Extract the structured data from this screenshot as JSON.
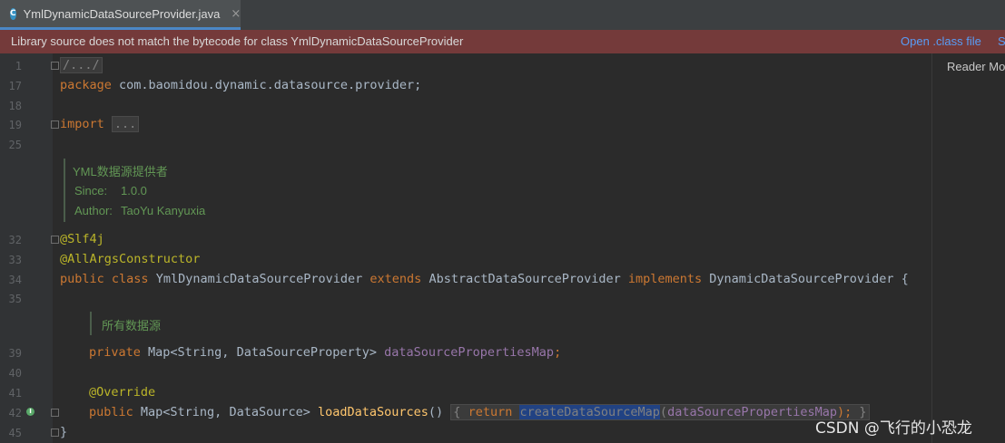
{
  "tab": {
    "label": "YmlDynamicDataSourceProvider.java",
    "icon": "C",
    "close": "×"
  },
  "banner": {
    "message": "Library source does not match the bytecode for class YmlDynamicDataSourceProvider",
    "open_class_file": "Open .class file",
    "more": "S"
  },
  "reader_mode": "Reader Mo",
  "lines": {
    "l1": "1",
    "l17": "17",
    "l18": "18",
    "l19": "19",
    "l25": "25",
    "l32": "32",
    "l33": "33",
    "l34": "34",
    "l35": "35",
    "l39": "39",
    "l40": "40",
    "l41": "41",
    "l42": "42",
    "l45": "45"
  },
  "code": {
    "fold_header": "/.../",
    "package_kw": "package",
    "package_name": " com.baomidou.dynamic.datasource.provider;",
    "import_kw": "import",
    "import_fold": "...",
    "ann_slf4j": "@Slf4j",
    "ann_allargs": "@AllArgsConstructor",
    "public_kw": "public",
    "class_kw": "class",
    "class_name": " YmlDynamicDataSourceProvider ",
    "extends_kw": "extends",
    "super_name": " AbstractDataSourceProvider ",
    "implements_kw": "implements",
    "iface_name": " DynamicDataSourceProvider {",
    "private_kw": "private",
    "field_type": " Map<String, DataSourceProperty> ",
    "field_name": "dataSourcePropertiesMap",
    "semicolon": ";",
    "override": "@Override",
    "method_type": " Map<String, DataSource> ",
    "method_name": "loadDataSources",
    "parens": "() ",
    "brace_open": "{ ",
    "return_kw": "return",
    "call_a": "createDa",
    "call_b": "taSourceMap",
    "arg_open": "(",
    "arg_name": "dataSourcePropertiesMap",
    "arg_close": "); ",
    "brace_close": "}",
    "class_close": "}"
  },
  "doc": {
    "class_summary": "YML数据源提供者",
    "since_label": "Since:",
    "since_value": "1.0.0",
    "author_label": "Author:",
    "author_value": "TaoYu Kanyuxia",
    "field_summary": "所有数据源"
  },
  "watermark": "CSDN @飞行的小恐龙"
}
